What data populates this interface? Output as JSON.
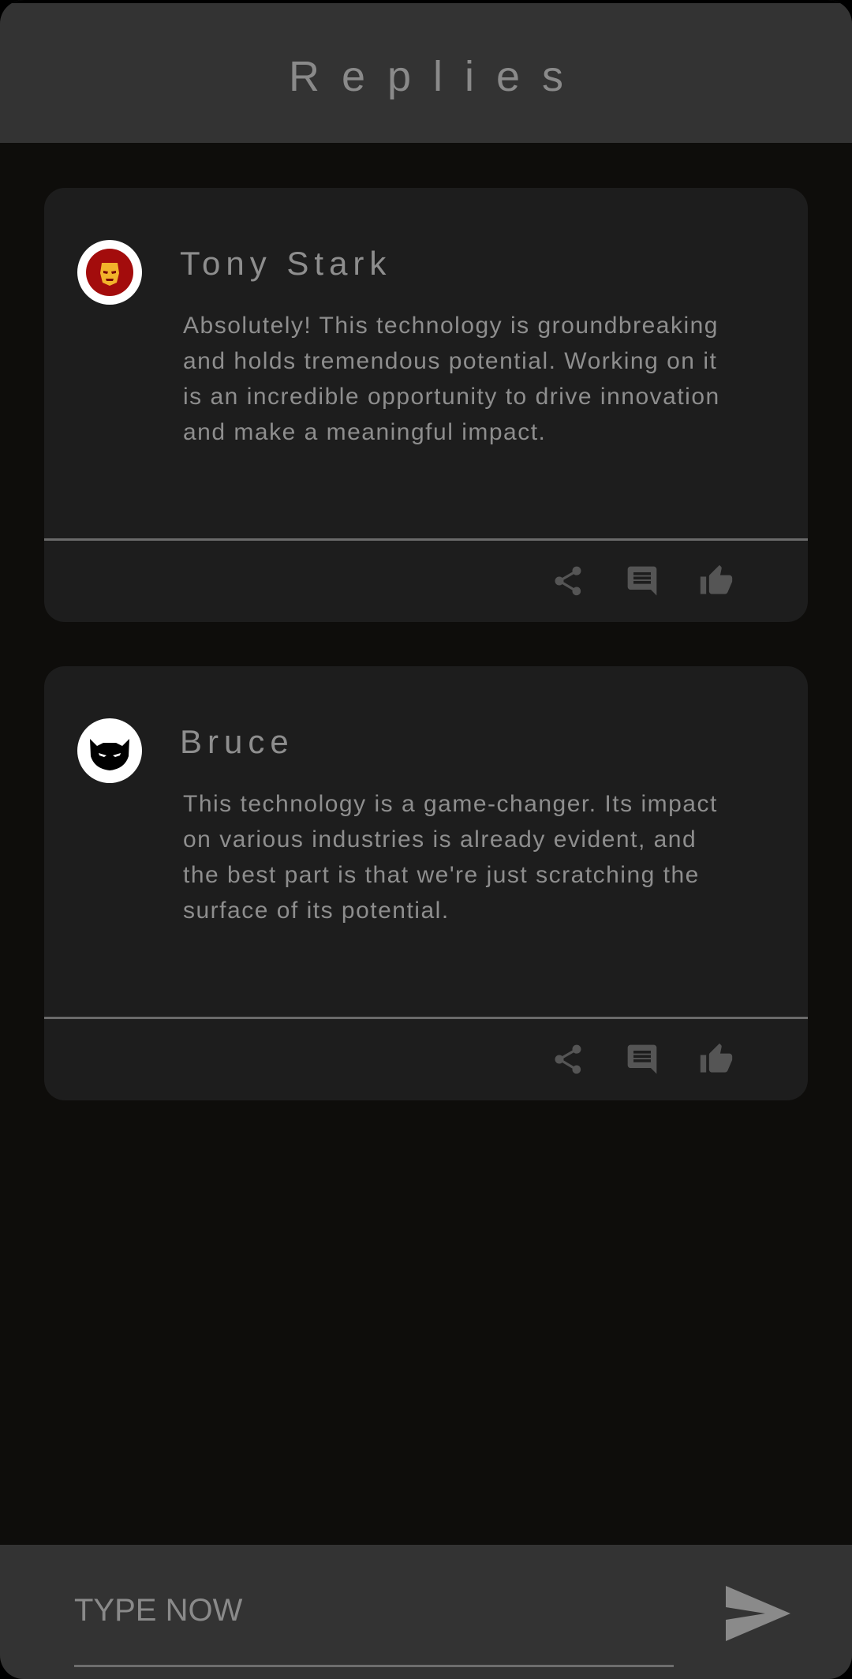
{
  "header": {
    "title": "Replies"
  },
  "replies": [
    {
      "author": "Tony Stark",
      "avatar": "iron-man-avatar",
      "text": "Absolutely! This technology is groundbreaking and holds tremendous potential. Working on it is an incredible opportunity to drive innovation and make a meaningful impact.",
      "actions": [
        "share-icon",
        "comment-icon",
        "thumbs-up-icon"
      ]
    },
    {
      "author": "Bruce",
      "avatar": "batman-avatar",
      "text": "This technology is a game-changer. Its impact on various industries is already evident, and the best part is that we're just scratching the surface of its potential.",
      "actions": [
        "share-icon",
        "comment-icon",
        "thumbs-up-icon"
      ]
    }
  ],
  "composer": {
    "placeholder": "TYPE NOW",
    "value": "",
    "send_icon": "send-icon"
  },
  "colors": {
    "background": "#0e0d0b",
    "bar": "#333333",
    "card": "#1d1d1d",
    "text": "#8e8e8e",
    "icon": "#555555"
  }
}
